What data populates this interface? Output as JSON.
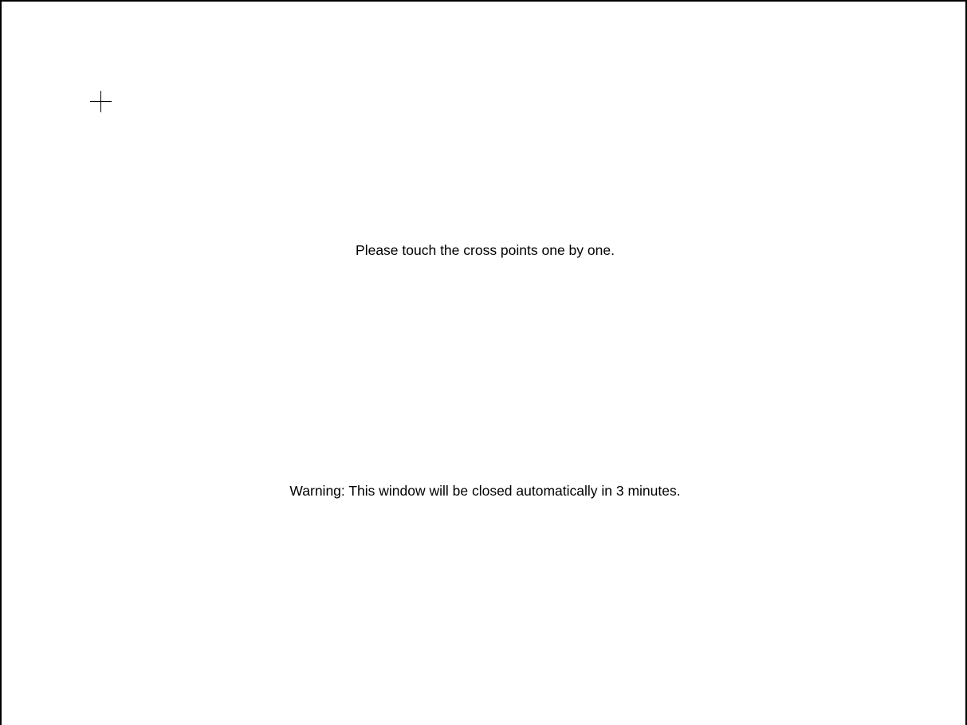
{
  "calibration": {
    "instruction": "Please touch the cross points one by one.",
    "warning": "Warning: This window will be closed automatically in 3 minutes.",
    "target_icon": "crosshair-icon",
    "colors": {
      "background": "#ffffff",
      "foreground": "#000000"
    }
  }
}
